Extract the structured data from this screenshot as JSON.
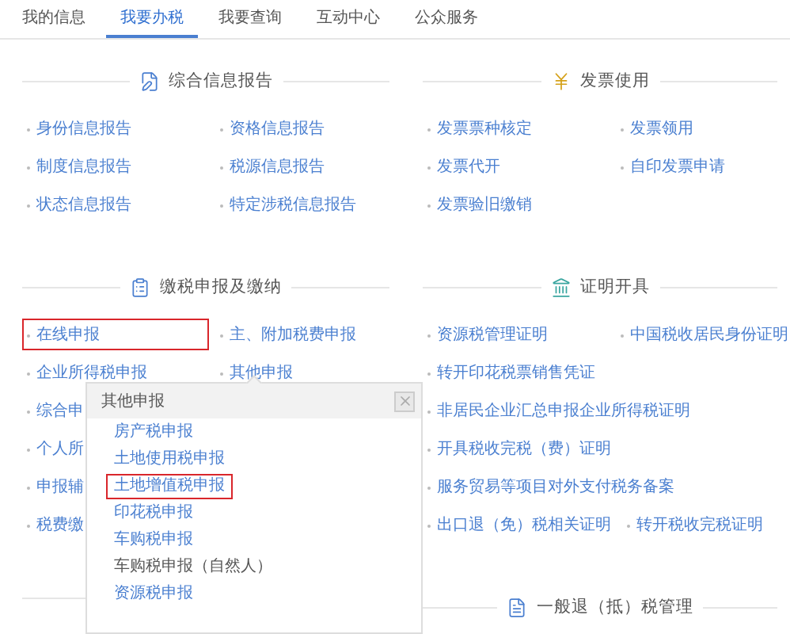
{
  "nav": [
    {
      "label": "我的信息",
      "selected": false
    },
    {
      "label": "我要办税",
      "selected": true
    },
    {
      "label": "我要查询",
      "selected": false
    },
    {
      "label": "互动中心",
      "selected": false
    },
    {
      "label": "公众服务",
      "selected": false
    }
  ],
  "columns": [
    {
      "sections": [
        {
          "title": "综合信息报告",
          "rows": [
            [
              {
                "label": "身份信息报告",
                "highlighted": false
              },
              {
                "label": "资格信息报告",
                "highlighted": false
              }
            ],
            [
              {
                "label": "制度信息报告",
                "highlighted": false
              },
              {
                "label": "税源信息报告",
                "highlighted": false
              }
            ],
            [
              {
                "label": "状态信息报告",
                "highlighted": false
              },
              {
                "label": "特定涉税信息报告",
                "highlighted": false
              }
            ]
          ]
        },
        {
          "title": "缴税申报及缴纳",
          "rows": [
            [
              {
                "label": "在线申报",
                "highlighted": true
              },
              {
                "label": "主、附加税费申报",
                "highlighted": false
              }
            ],
            [
              {
                "label": "企业所得税申报",
                "highlighted": false
              },
              {
                "label": "其他申报",
                "highlighted": false
              }
            ],
            [
              {
                "label": "综合申",
                "highlighted": false
              }
            ],
            [
              {
                "label": "个人所",
                "highlighted": false
              }
            ],
            [
              {
                "label": "申报辅",
                "highlighted": false
              }
            ],
            [
              {
                "label": "税费缴",
                "highlighted": false
              }
            ]
          ]
        }
      ]
    },
    {
      "sections": [
        {
          "title": "发票使用",
          "rows": [
            [
              {
                "label": "发票票种核定",
                "highlighted": false
              },
              {
                "label": "发票领用",
                "highlighted": false
              }
            ],
            [
              {
                "label": "发票代开",
                "highlighted": false
              },
              {
                "label": "自印发票申请",
                "highlighted": false
              }
            ],
            [
              {
                "label": "发票验旧缴销",
                "highlighted": false
              }
            ]
          ]
        },
        {
          "title": "证明开具",
          "rows": [
            [
              {
                "label": "资源税管理证明",
                "highlighted": false
              },
              {
                "label": "中国税收居民身份证明",
                "highlighted": false
              }
            ],
            [
              {
                "label": "转开印花税票销售凭证",
                "highlighted": false
              }
            ],
            [
              {
                "label": "非居民企业汇总申报企业所得税证明",
                "highlighted": false
              }
            ],
            [
              {
                "label": "开具税收完税（费）证明",
                "highlighted": false
              }
            ],
            [
              {
                "label": "服务贸易等项目对外支付税务备案",
                "highlighted": false
              }
            ],
            [
              {
                "label": "出口退（免）税相关证明",
                "highlighted": false
              },
              {
                "label": "转开税收完税证明",
                "highlighted": false
              }
            ]
          ]
        },
        {
          "title": "一般退（抵）税管理"
        }
      ]
    }
  ],
  "popup": {
    "title": "其他申报",
    "items": [
      {
        "label": "房产税申报",
        "highlighted": false,
        "kind": "link"
      },
      {
        "label": "土地使用税申报",
        "highlighted": false,
        "kind": "link"
      },
      {
        "label": "土地增值税申报",
        "highlighted": true,
        "kind": "link"
      },
      {
        "label": "印花税申报",
        "highlighted": false,
        "kind": "link"
      },
      {
        "label": "车购税申报",
        "highlighted": false,
        "kind": "link"
      },
      {
        "label": "车购税申报（自然人）",
        "highlighted": false,
        "kind": "text"
      },
      {
        "label": "资源税申报",
        "highlighted": false,
        "kind": "link"
      }
    ]
  }
}
